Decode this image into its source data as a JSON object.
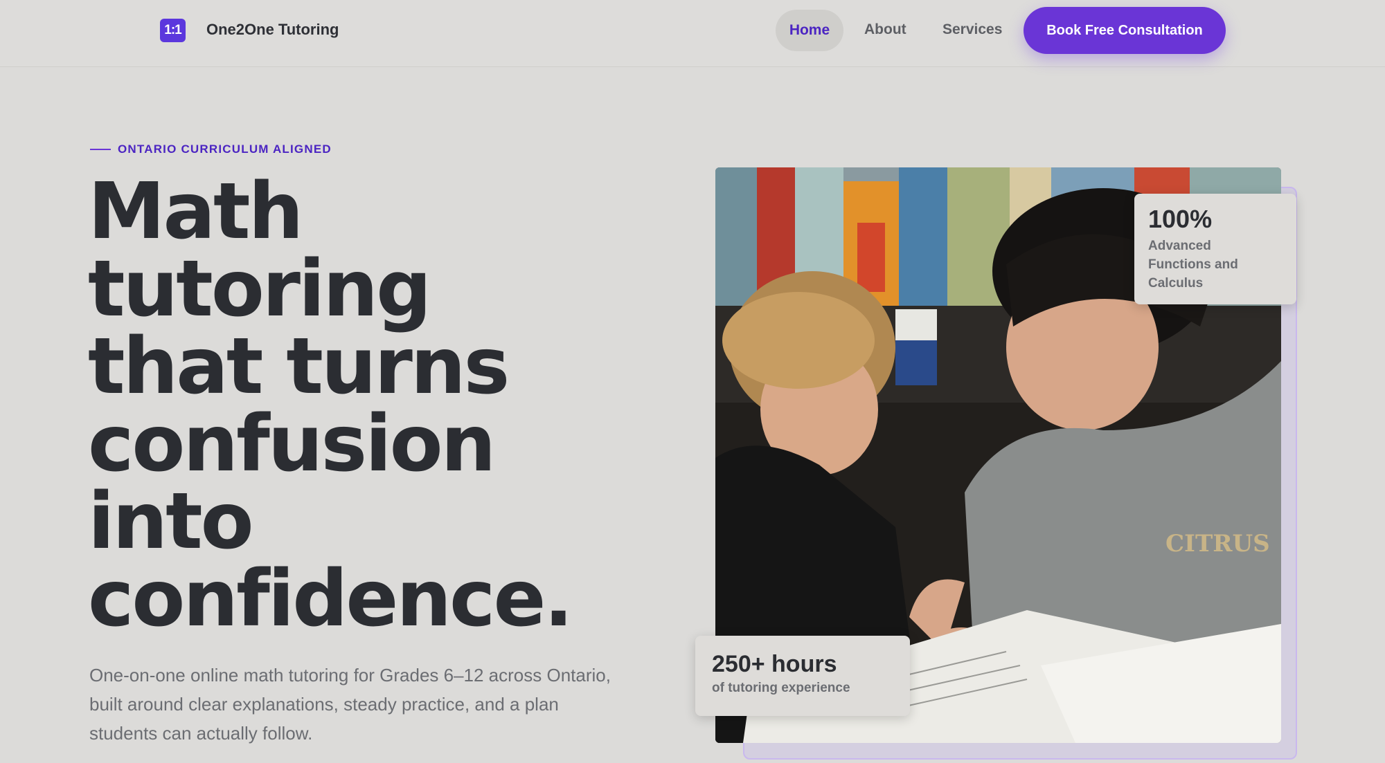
{
  "header": {
    "logo_text": "1:1",
    "brand": "One2One Tutoring",
    "nav": {
      "home": "Home",
      "about": "About",
      "services": "Services"
    },
    "cta": "Book Free Consultation"
  },
  "hero": {
    "eyebrow": "ONTARIO CURRICULUM ALIGNED",
    "headline": "Math tutoring that turns confusion into confidence.",
    "subtext": "One-on-one online math tutoring for Grades 6–12 across Ontario, built around clear explanations, steady practice, and a plan students can actually follow."
  },
  "stats": {
    "top": {
      "value": "100%",
      "label": "Advanced Functions and Calculus"
    },
    "bottom": {
      "value": "250+ hours",
      "label": "of tutoring experience"
    }
  },
  "photo": {
    "shirt_text": "CITRUS"
  },
  "colors": {
    "accent": "#6a35d6",
    "accent_dark": "#4b24c2",
    "background": "#dcdbd9",
    "heading": "#2b2d32",
    "muted": "#6b6d72"
  }
}
